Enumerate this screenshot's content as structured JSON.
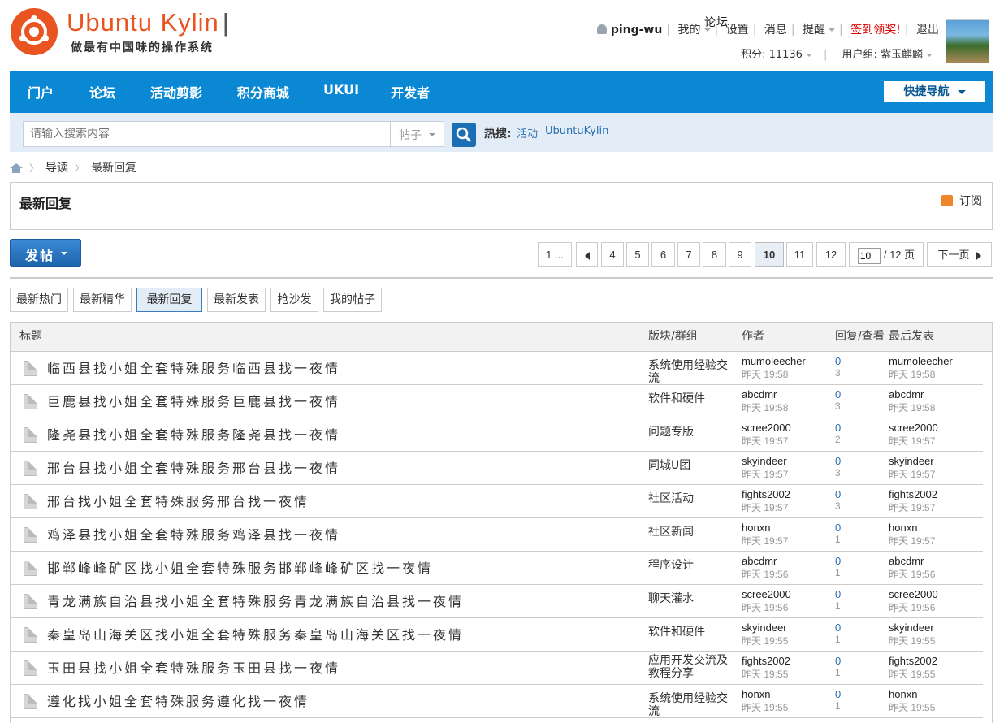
{
  "header": {
    "brand": "Ubuntu Kylin",
    "brand_sep": "|",
    "brand_forum": "论坛",
    "slogan": "做最有中国味的操作系统",
    "user": {
      "username": "ping-wu",
      "menu_mine": "我的",
      "settings": "设置",
      "messages": "消息",
      "reminders": "提醒",
      "sign_in": "签到领奖!",
      "logout": "退出",
      "points_label": "积分: 11136",
      "group_label": "用户组: 紫玉麒麟"
    }
  },
  "nav": {
    "items": [
      "门户",
      "论坛",
      "活动剪影",
      "积分商城",
      "UKUI",
      "开发者"
    ],
    "quick_nav": "快捷导航"
  },
  "search": {
    "placeholder": "请输入搜索内容",
    "type": "帖子",
    "hot_label": "热搜:",
    "hot_links": [
      "活动",
      "UbuntuKylin"
    ]
  },
  "breadcrumb": [
    "导读",
    "最新回复"
  ],
  "section": {
    "title": "最新回复",
    "subscribe": "订阅"
  },
  "post_button": "发帖",
  "pager": {
    "first": "1 ...",
    "pages": [
      "4",
      "5",
      "6",
      "7",
      "8",
      "9",
      "10",
      "11",
      "12"
    ],
    "current": "10",
    "input_value": "10",
    "total": "/ 12 页",
    "next": "下一页"
  },
  "filter_tabs": [
    "最新热门",
    "最新精华",
    "最新回复",
    "最新发表",
    "抢沙发",
    "我的帖子"
  ],
  "active_tab": "最新回复",
  "table": {
    "headers": {
      "title": "标题",
      "forum": "版块/群组",
      "author": "作者",
      "reply_view": "回复/查看",
      "last_post": "最后发表"
    },
    "rows": [
      {
        "title": "临西县找小姐全套特殊服务临西县找一夜情",
        "forum": "系统使用经验交流",
        "author": "mumoleecher",
        "time": "昨天 19:58",
        "replies": "0",
        "views": "3",
        "last_author": "mumoleecher",
        "last_time": "昨天 19:58"
      },
      {
        "title": "巨鹿县找小姐全套特殊服务巨鹿县找一夜情",
        "forum": "软件和硬件",
        "author": "abcdmr",
        "time": "昨天 19:58",
        "replies": "0",
        "views": "3",
        "last_author": "abcdmr",
        "last_time": "昨天 19:58"
      },
      {
        "title": "隆尧县找小姐全套特殊服务隆尧县找一夜情",
        "forum": "问题专版",
        "author": "scree2000",
        "time": "昨天 19:57",
        "replies": "0",
        "views": "2",
        "last_author": "scree2000",
        "last_time": "昨天 19:57"
      },
      {
        "title": "邢台县找小姐全套特殊服务邢台县找一夜情",
        "forum": "同城U团",
        "author": "skyindeer",
        "time": "昨天 19:57",
        "replies": "0",
        "views": "3",
        "last_author": "skyindeer",
        "last_time": "昨天 19:57"
      },
      {
        "title": "邢台找小姐全套特殊服务邢台找一夜情",
        "forum": "社区活动",
        "author": "fights2002",
        "time": "昨天 19:57",
        "replies": "0",
        "views": "3",
        "last_author": "fights2002",
        "last_time": "昨天 19:57"
      },
      {
        "title": "鸡泽县找小姐全套特殊服务鸡泽县找一夜情",
        "forum": "社区新闻",
        "author": "honxn",
        "time": "昨天 19:57",
        "replies": "0",
        "views": "1",
        "last_author": "honxn",
        "last_time": "昨天 19:57"
      },
      {
        "title": "邯郸峰峰矿区找小姐全套特殊服务邯郸峰峰矿区找一夜情",
        "forum": "程序设计",
        "author": "abcdmr",
        "time": "昨天 19:56",
        "replies": "0",
        "views": "1",
        "last_author": "abcdmr",
        "last_time": "昨天 19:56"
      },
      {
        "title": "青龙满族自治县找小姐全套特殊服务青龙满族自治县找一夜情",
        "forum": "聊天灌水",
        "author": "scree2000",
        "time": "昨天 19:56",
        "replies": "0",
        "views": "1",
        "last_author": "scree2000",
        "last_time": "昨天 19:56"
      },
      {
        "title": "秦皇岛山海关区找小姐全套特殊服务秦皇岛山海关区找一夜情",
        "forum": "软件和硬件",
        "author": "skyindeer",
        "time": "昨天 19:55",
        "replies": "0",
        "views": "1",
        "last_author": "skyindeer",
        "last_time": "昨天 19:55"
      },
      {
        "title": "玉田县找小姐全套特殊服务玉田县找一夜情",
        "forum": "应用开发交流及教程分享",
        "author": "fights2002",
        "time": "昨天 19:55",
        "replies": "0",
        "views": "1",
        "last_author": "fights2002",
        "last_time": "昨天 19:55"
      },
      {
        "title": "遵化找小姐全套特殊服务遵化找一夜情",
        "forum": "系统使用经验交流",
        "author": "honxn",
        "time": "昨天 19:55",
        "replies": "0",
        "views": "1",
        "last_author": "honxn",
        "last_time": "昨天 19:55"
      }
    ]
  },
  "colors": {
    "brand_orange": "#e95420",
    "nav_blue": "#0b88d4",
    "link_blue": "#2a6db0",
    "sign_red": "#dd0000"
  }
}
